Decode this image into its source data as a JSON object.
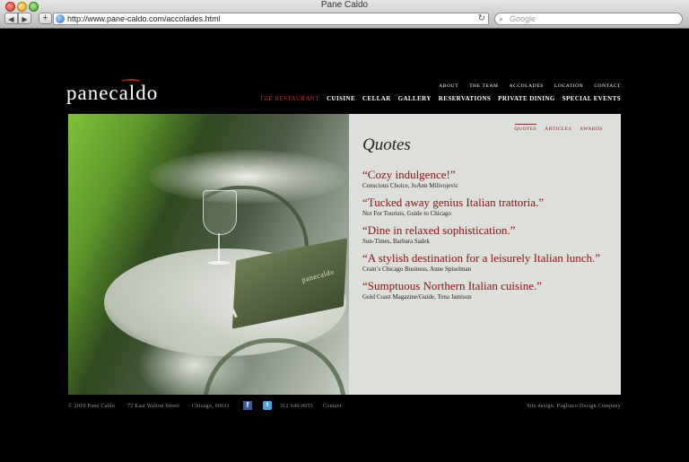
{
  "browser": {
    "window_title": "Pane Caldo",
    "url": "http://www.pane-caldo.com/accolades.html",
    "search_placeholder": "Google",
    "back_glyph": "◀",
    "forward_glyph": "▶",
    "add_glyph": "+",
    "reload_glyph": "↻"
  },
  "site": {
    "logo": "panecaldo",
    "top_nav": [
      "ABOUT",
      "THE TEAM",
      "ACCOLADES",
      "LOCATION",
      "CONTACT"
    ],
    "main_nav": [
      "THE RESTAURANT",
      "CUISINE",
      "CELLAR",
      "GALLERY",
      "RESERVATIONS",
      "PRIVATE DINING",
      "SPECIAL EVENTS"
    ],
    "main_nav_active": "THE RESTAURANT",
    "photo_menu_label": "panecaldo",
    "colors": {
      "accent": "#c22a2a",
      "quote": "#8b0f12",
      "background": "#000000"
    }
  },
  "panel": {
    "sub_nav": [
      "QUOTES",
      "ARTICLES",
      "AWARDS"
    ],
    "sub_nav_active": "QUOTES",
    "title": "Quotes",
    "quotes": [
      {
        "text": "“Cozy indulgence!”",
        "source": "Conscious Choice, JoAnn Milivojevic"
      },
      {
        "text": "“Tucked away genius Italian trattoria.”",
        "source": "Not For Tourists, Guide to Chicago"
      },
      {
        "text": "“Dine in relaxed sophistication.”",
        "source": "Sun-Times, Barbara Sadek"
      },
      {
        "text": "“A stylish destination for a leisurely Italian lunch.”",
        "source": "Crain’s Chicago Business, Anne Spiselman"
      },
      {
        "text": "“Sumptuous Northern Italian cuisine.”",
        "source": "Gold Coast Magazine/Guide, Tena Jamison"
      }
    ]
  },
  "footer": {
    "copyright": "© 2010 Pane Caldo",
    "address": "72 East Walton Street",
    "city": "Chicago, 60611",
    "facebook_glyph": "f",
    "twitter_glyph": "t",
    "phone": "312 649-0055",
    "contact": "Contact",
    "credit": "Site design: Pagliuco Design Company"
  }
}
